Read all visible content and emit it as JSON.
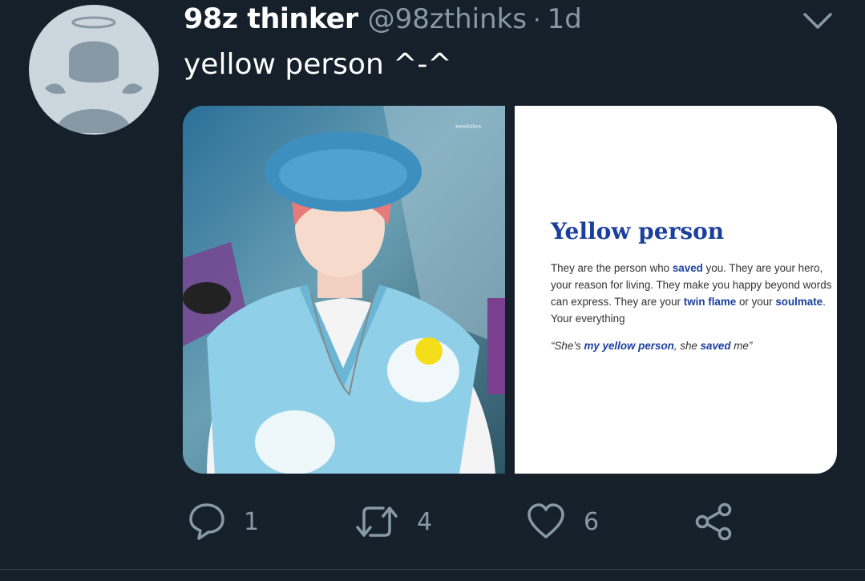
{
  "tweet": {
    "display_name": "98z thinker",
    "handle": "@98zthinks",
    "separator": "·",
    "timestamp": "1d",
    "text": "yellow person ^-^"
  },
  "media": {
    "photo_watermark": "newbitex",
    "card": {
      "title": "Yellow person",
      "body_parts": [
        "They are the person who ",
        "saved",
        " you. They are your hero, your reason for living. They make you happy beyond words can express. They are your ",
        "twin flame",
        " or your ",
        "soulmate",
        ". Your everything"
      ],
      "quote_parts": [
        "“She’s ",
        "my yellow person",
        ", she ",
        "saved",
        " me”"
      ]
    }
  },
  "actions": {
    "reply_count": "1",
    "retweet_count": "4",
    "like_count": "6"
  },
  "icons": {
    "avatar": "default-angel-avatar-icon",
    "menu": "chevron-down-icon",
    "reply": "reply-icon",
    "retweet": "retweet-icon",
    "like": "heart-icon",
    "share": "share-icon"
  },
  "colors": {
    "background": "#15202b",
    "muted": "#8899a6",
    "text": "#ffffff",
    "card_accent": "#1b3f9e"
  }
}
